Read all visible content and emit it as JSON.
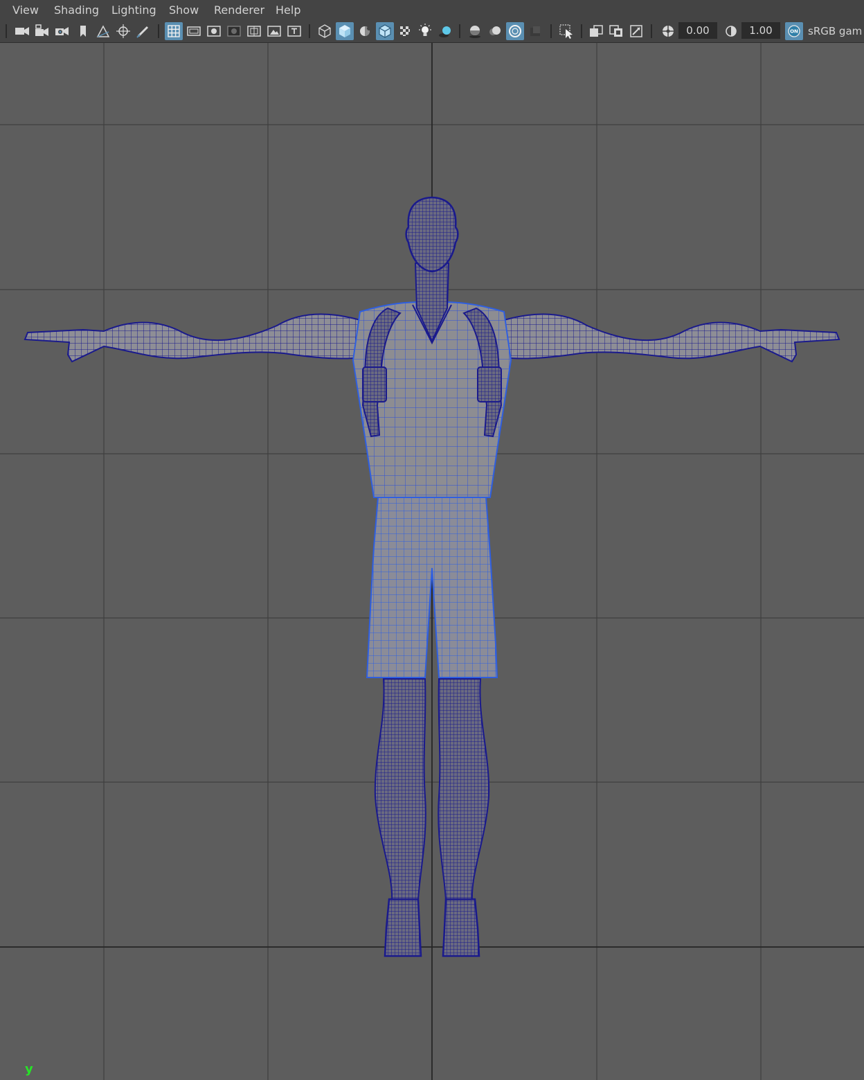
{
  "menu": {
    "view": "View",
    "shading": "Shading",
    "lighting": "Lighting",
    "show": "Show",
    "renderer": "Renderer",
    "help": "Help"
  },
  "toolbar": {
    "exposure_value": "0.00",
    "gamma_value": "1.00",
    "color_management_badge": "ON",
    "color_space_label": "sRGB gam",
    "icons": [
      "camera-icon",
      "camera-lock-icon",
      "camera-attributes-icon",
      "bookmark-icon",
      "image-plane-icon",
      "two-d-pan-zoom-icon",
      "grease-pencil-icon",
      "grid-icon",
      "film-gate-icon",
      "resolution-gate-icon",
      "gate-mask-icon",
      "field-chart-icon",
      "safe-action-icon",
      "safe-title-icon",
      "wireframe-icon",
      "smooth-shade-icon",
      "default-material-icon",
      "wireframe-on-shaded-icon",
      "textured-icon",
      "use-all-lights-icon",
      "shadows-icon",
      "screen-space-ao-icon",
      "motion-blur-icon",
      "anti-aliasing-icon",
      "depth-of-field-icon",
      "isolate-select-icon",
      "xray-icon",
      "xray-joints-icon",
      "xray-components-icon",
      "exposure-icon",
      "gamma-icon",
      "color-management-icon"
    ]
  },
  "viewport": {
    "axis_label": "y",
    "wire_color": "#1a1a8c",
    "highlight_wire_color": "#2f5fe0",
    "grid_color": "#3e3e3e"
  },
  "colors": {
    "menubar_bg": "#444444",
    "viewport_bg": "#5d5d5d",
    "active_icon_bg": "#5a8fb2",
    "axis_label": "#27e427"
  }
}
